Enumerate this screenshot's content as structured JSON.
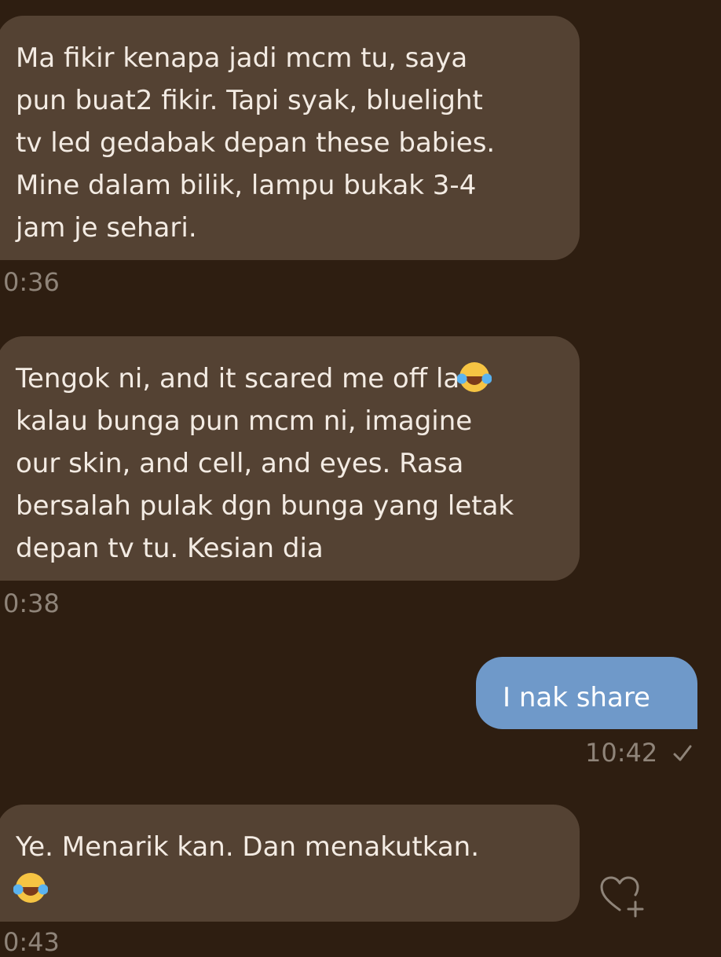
{
  "messages": [
    {
      "direction": "incoming",
      "lines": [
        "Ma fikir kenapa jadi mcm tu, saya",
        "pun buat2 fikir. Tapi syak, bluelight",
        "tv led gedabak depan these babies.",
        "Mine dalam bilik, lampu bukak 3-4",
        "jam je sehari."
      ],
      "time": "0:36"
    },
    {
      "direction": "incoming",
      "lines": [
        "Tengok ni, and it scared me off la",
        "kalau bunga pun mcm ni, imagine",
        "our skin, and cell, and eyes. Rasa",
        "bersalah pulak dgn bunga yang letak",
        "depan tv tu. Kesian dia"
      ],
      "emoji": "face-with-tears-of-joy",
      "time": "0:38"
    },
    {
      "direction": "outgoing",
      "text": "I nak share",
      "time": "10:42",
      "status_icon": "check-icon"
    },
    {
      "direction": "incoming",
      "text": "Ye. Menarik kan. Dan menakutkan.",
      "emoji": "face-with-tears-of-joy",
      "time": "0:43",
      "reaction_icon": "add-reaction-heart-icon"
    }
  ],
  "colors": {
    "background": "#2e1e11",
    "incoming_bubble": "#544233",
    "outgoing_bubble": "#6f99c9",
    "timestamp": "#8f8479"
  }
}
